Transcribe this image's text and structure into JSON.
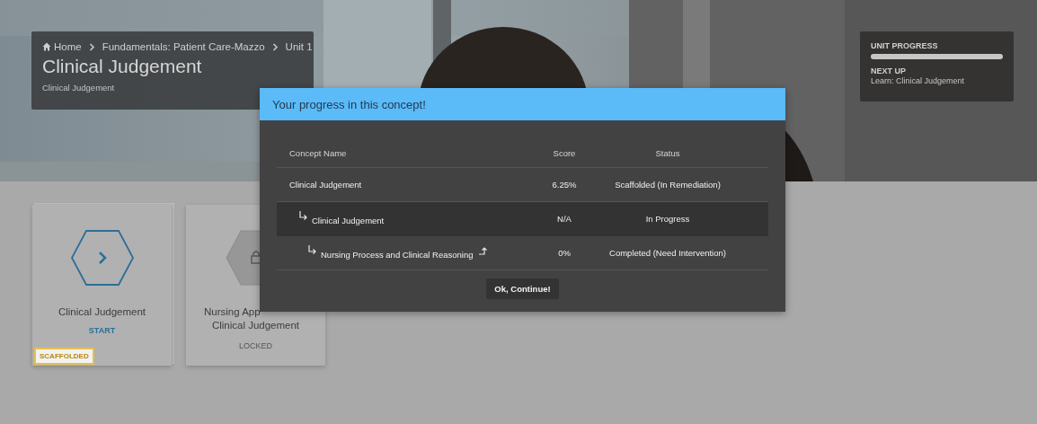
{
  "breadcrumb": [
    {
      "label": "Home",
      "kind": "home"
    },
    {
      "label": "Fundamentals: Patient Care-Mazzo",
      "kind": "link"
    },
    {
      "label": "Unit 1",
      "kind": "link"
    }
  ],
  "page_title": "Clinical Judgement",
  "page_subtitle": "Clinical Judgement",
  "unit_progress": {
    "label": "UNIT PROGRESS",
    "level": 0,
    "next_label": "NEXT UP",
    "next_value": "Learn: Clinical Judgement"
  },
  "cards": [
    {
      "kind": "start",
      "title_lines": [
        "Clinical Judgement"
      ],
      "action": "START",
      "badge": "SCAFFOLDED"
    },
    {
      "kind": "locked",
      "title_lines": [
        "Nursing App",
        "Clinical Judgement"
      ],
      "action": "LOCKED"
    }
  ],
  "modal": {
    "title": "Your progress in this concept!",
    "columns": [
      "Concept Name",
      "Score",
      "Status"
    ],
    "rows": [
      {
        "name": "Clinical Judgement",
        "score": "6.25%",
        "status": "Scaffolded (In Remediation)",
        "selected": false,
        "children": [
          {
            "name": "Clinical Judgement",
            "score": "N/A",
            "status": "In Progress",
            "selected": true,
            "children": [
              {
                "name": "Nursing Process and Clinical Reasoning",
                "score": "0%",
                "status": "Completed (Need Intervention)",
                "selected": false,
                "jump": true
              }
            ]
          }
        ]
      }
    ],
    "button": "Ok, Continue!"
  }
}
